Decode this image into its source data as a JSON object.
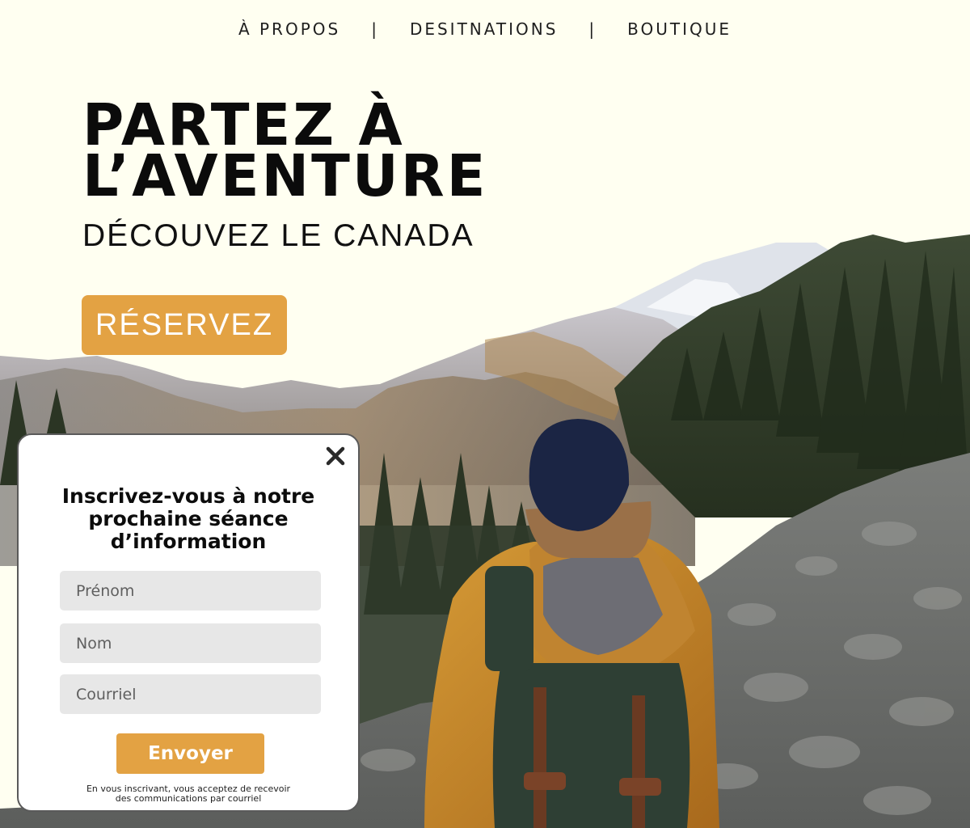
{
  "nav": {
    "items": [
      {
        "label": "À PROPOS"
      },
      {
        "label": "DESITNATIONS"
      },
      {
        "label": "BOUTIQUE"
      }
    ],
    "separator": "|"
  },
  "hero": {
    "title_line1": "PARTEZ À",
    "title_line2": "L’AVENTURE",
    "subtitle": "DÉCOUVEZ LE CANADA",
    "cta_label": "RÉSERVEZ"
  },
  "popup": {
    "close_icon": "close-icon",
    "title_line1": "Inscrivez-vous à notre",
    "title_line2": "prochaine séance",
    "title_line3": "d’information",
    "fields": {
      "first_name": {
        "placeholder": "Prénom",
        "value": ""
      },
      "last_name": {
        "placeholder": "Nom",
        "value": ""
      },
      "email": {
        "placeholder": "Courriel",
        "value": ""
      }
    },
    "submit_label": "Envoyer",
    "legal_line1": "En vous inscrivant, vous acceptez de recevoir",
    "legal_line2": "des communications par courriel"
  },
  "colors": {
    "background": "#fffff1",
    "accent": "#e3a243",
    "text": "#0b0b0b",
    "field": "#e7e7e7"
  }
}
